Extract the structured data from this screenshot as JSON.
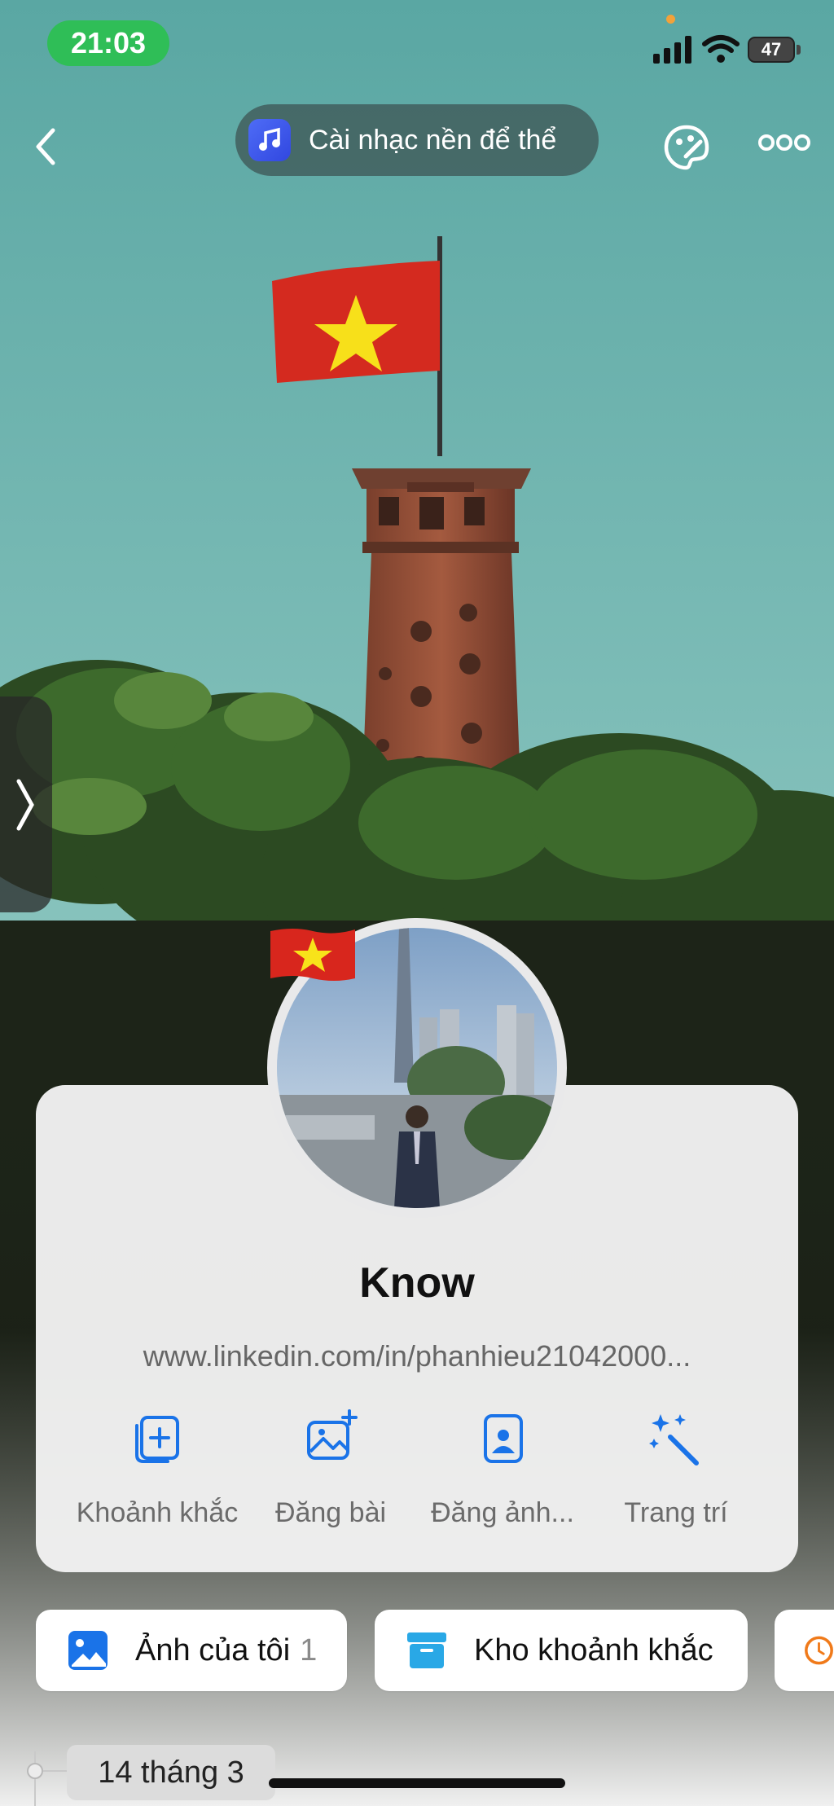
{
  "status_bar": {
    "time": "21:03",
    "battery": "47",
    "accent": "#2fbe57"
  },
  "nav": {
    "back_icon": "chevron-left-icon",
    "music_label": "Cài nhạc nền để thể",
    "theme_icon": "palette-icon",
    "more_icon": "more-horizontal-icon"
  },
  "side_handle": {
    "icon": "chevron-right-icon"
  },
  "profile": {
    "name": "Know",
    "bio": "www.linkedin.com/in/phanhieu21042000...",
    "badge_icon": "vietnam-flag-icon",
    "actions": [
      {
        "label": "Khoảnh khắc",
        "icon": "add-moment-icon"
      },
      {
        "label": "Đăng bài",
        "icon": "add-photo-icon"
      },
      {
        "label": "Đăng ảnh...",
        "icon": "portrait-upload-icon"
      },
      {
        "label": "Trang trí",
        "icon": "magic-wand-icon"
      }
    ],
    "accent": "#1a73e8"
  },
  "pills": [
    {
      "label": "Ảnh của tôi",
      "count": "1",
      "icon": "image-icon"
    },
    {
      "label": "Kho khoảnh khắc",
      "icon": "archive-box-icon"
    },
    {
      "icon": "clock-icon"
    }
  ],
  "timeline": {
    "date": "14 tháng 3"
  }
}
